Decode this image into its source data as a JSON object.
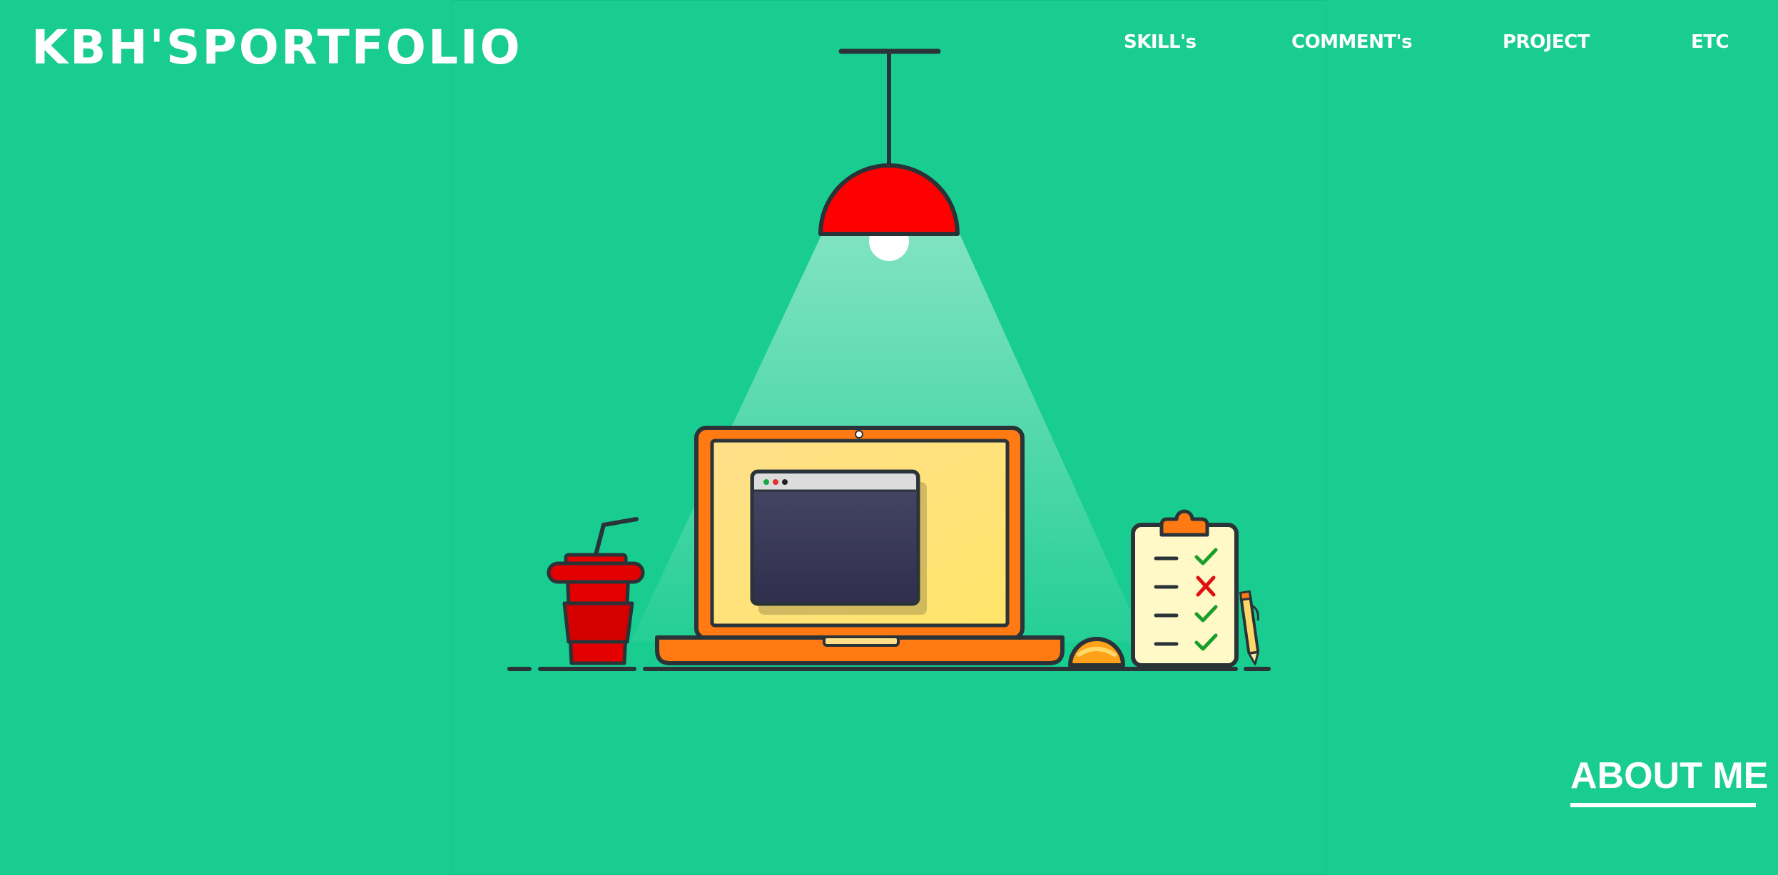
{
  "header": {
    "logo_text": "KBH'SPORTFOLIO",
    "nav": [
      {
        "label": "SKILL's"
      },
      {
        "label": "COMMENT's"
      },
      {
        "label": "PROJECT"
      },
      {
        "label": "ETC"
      }
    ]
  },
  "hero": {
    "illustration": "workspace illustration: pendant lamp, laptop with window, drink cup, mouse, checklist clipboard, pencil",
    "icons": [
      "lamp-icon",
      "laptop-icon",
      "cup-icon",
      "mouse-icon",
      "clipboard-icon",
      "pencil-icon"
    ]
  },
  "footer_link": {
    "label": "ABOUT ME"
  },
  "colors": {
    "background": "#19cc8f",
    "text": "#ffffff",
    "lamp": "#ff0000",
    "laptop": "#ff7a12",
    "screen": "#ffe27a",
    "window": "#3b3b58",
    "outline": "#2a3338",
    "check": "#1a9e2a",
    "cross": "#e01010"
  }
}
